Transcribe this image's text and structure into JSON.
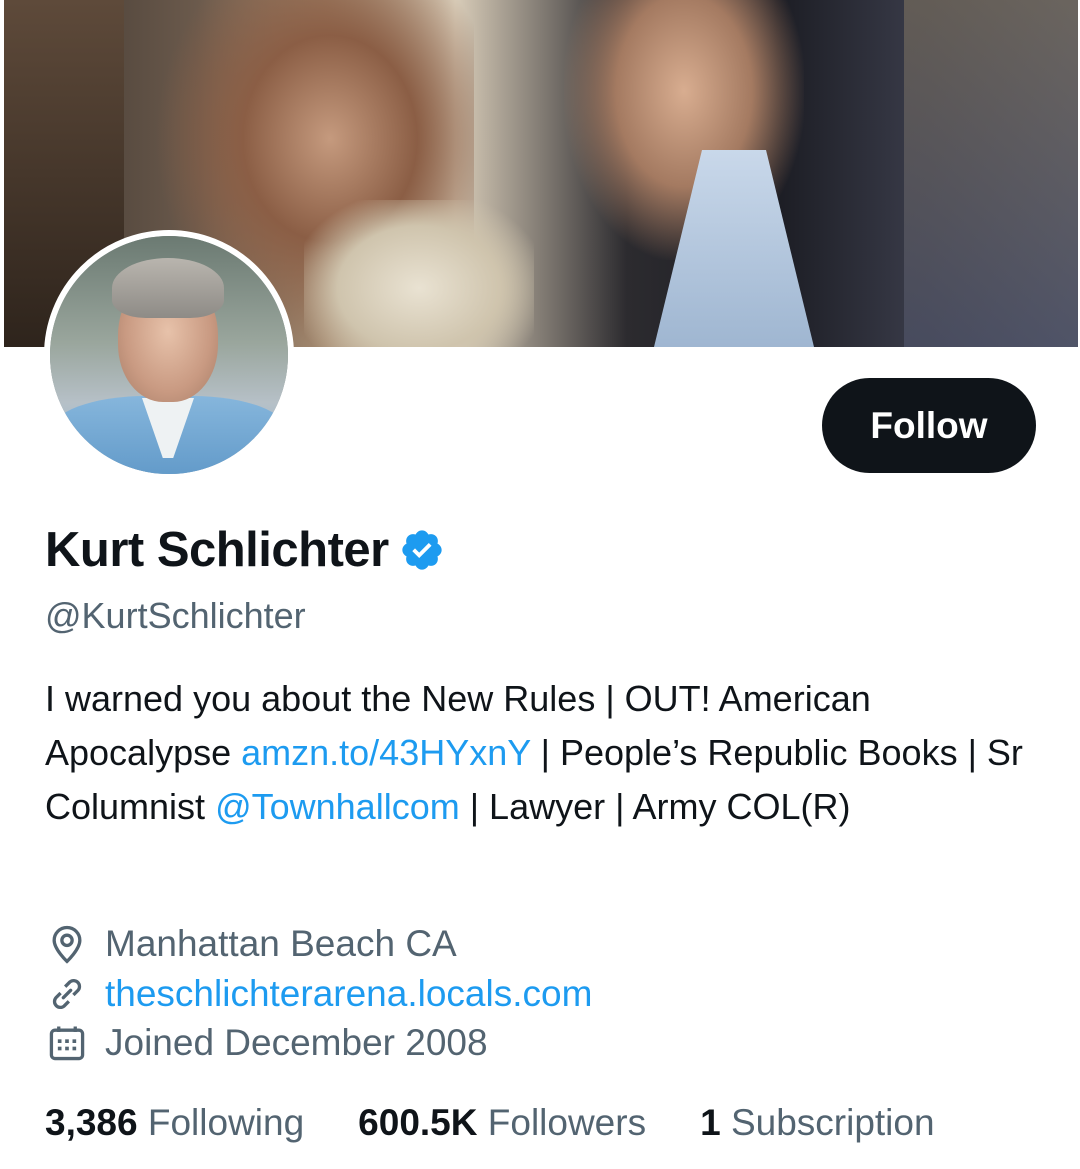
{
  "profile": {
    "name": "Kurt Schlichter",
    "handle": "@KurtSchlichter",
    "follow_label": "Follow",
    "bio": {
      "p1": "I warned you about the New Rules | OUT! American Apocalypse ",
      "link1": "amzn.to/43HYxnY",
      "p2": " | People’s Republic Books | Sr Columnist ",
      "link2": "@Townhallcom",
      "p3": " | Lawyer | Army COL(R)"
    },
    "location": "Manhattan Beach CA",
    "website": "theschlichterarena.locals.com",
    "joined": "Joined December 2008"
  },
  "stats": {
    "following_count": "3,386",
    "following_label": "Following",
    "followers_count": "600.5K",
    "followers_label": "Followers",
    "subscriptions_count": "1",
    "subscriptions_label": "Subscription"
  },
  "colors": {
    "accent": "#1d9bf0",
    "text": "#0f1419",
    "secondary": "#536471",
    "button": "#0f1419"
  },
  "icons": {
    "verified": "verified-badge-icon",
    "location": "location-pin-icon",
    "website": "link-icon",
    "joined": "calendar-icon"
  }
}
